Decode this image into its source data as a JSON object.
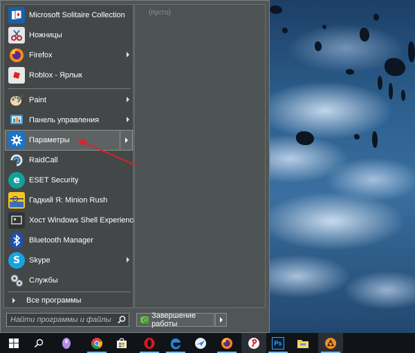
{
  "start_menu": {
    "pinned_items": [
      {
        "label": "Microsoft Solitaire Collection",
        "icon": "solitaire-icon",
        "has_arrow": false
      },
      {
        "label": "Ножницы",
        "icon": "scissors-icon",
        "has_arrow": false
      },
      {
        "label": "Firefox",
        "icon": "firefox-icon",
        "has_arrow": true
      },
      {
        "label": "Roblox - Ярлык",
        "icon": "roblox-icon",
        "has_arrow": false
      }
    ],
    "recent_items": [
      {
        "label": "Paint",
        "icon": "paint-icon",
        "has_arrow": true
      },
      {
        "label": "Панель управления",
        "icon": "control-panel-icon",
        "has_arrow": true
      },
      {
        "label": "Параметры",
        "icon": "gear-icon",
        "has_arrow": true,
        "active": true
      },
      {
        "label": "RaidCall",
        "icon": "raidcall-icon",
        "has_arrow": false
      },
      {
        "label": "ESET Security",
        "icon": "eset-icon",
        "has_arrow": false
      },
      {
        "label": "Гадкий Я: Minion Rush",
        "icon": "minion-rush-icon",
        "has_arrow": false
      },
      {
        "label": "Хост Windows Shell Experience",
        "icon": "shell-experience-icon",
        "has_arrow": false
      },
      {
        "label": "Bluetooth Manager",
        "icon": "bluetooth-icon",
        "has_arrow": false
      },
      {
        "label": "Skype",
        "icon": "skype-icon",
        "has_arrow": true
      },
      {
        "label": "Службы",
        "icon": "services-icon",
        "has_arrow": false
      }
    ],
    "all_programs_label": "Все программы",
    "places_empty_label": "(пусто)",
    "search": {
      "placeholder": "Найти программы и файлы"
    },
    "shutdown_label": "Завершение работы"
  },
  "taskbar": {
    "icons": [
      "windows-start-icon",
      "search-icon",
      "cortana-icon",
      "chrome-icon",
      "store-icon",
      "opera-icon",
      "edge-icon",
      "airplane-app-icon",
      "firefox-icon",
      "yandex-icon",
      "photoshop-icon",
      "file-explorer-icon",
      "app-icon"
    ],
    "photoshop_label": "Ps"
  },
  "colors": {
    "menu_bg": "#505556",
    "annotation_arrow": "#e0202a",
    "taskbar_bg": "#101418"
  }
}
